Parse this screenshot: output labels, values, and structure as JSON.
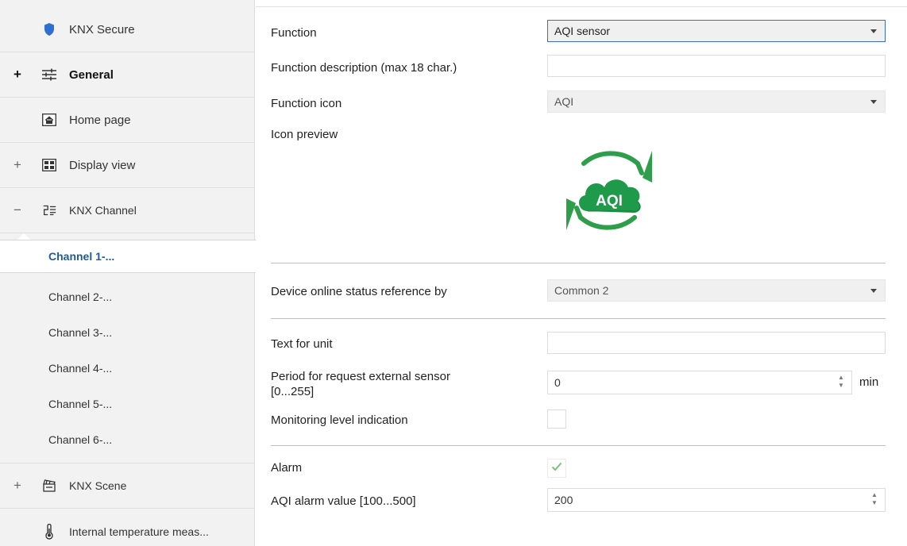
{
  "sidebar": {
    "items": [
      {
        "label": "KNX Secure",
        "expander": "",
        "icon": "shield-icon"
      },
      {
        "label": "General",
        "expander": "+",
        "icon": "sliders-icon"
      },
      {
        "label": "Home page",
        "expander": "",
        "icon": "home-icon"
      },
      {
        "label": "Display view",
        "expander": "+",
        "icon": "display-view-icon"
      },
      {
        "label": "KNX Channel",
        "expander": "−",
        "icon": "knx-channel-icon"
      },
      {
        "label": "KNX Scene",
        "expander": "+",
        "icon": "scene-icon"
      },
      {
        "label": "Internal temperature meas...",
        "expander": "",
        "icon": "thermometer-icon"
      }
    ],
    "channels": [
      "Channel 1-...",
      "Channel 2-...",
      "Channel 3-...",
      "Channel 4-...",
      "Channel 5-...",
      "Channel 6-..."
    ]
  },
  "main": {
    "function": {
      "label": "Function",
      "value": "AQI sensor"
    },
    "function_description": {
      "label": "Function description (max 18 char.)",
      "value": ""
    },
    "function_icon": {
      "label": "Function icon",
      "value": "AQI"
    },
    "icon_preview": {
      "label": "Icon preview",
      "icon_text": "AQI",
      "icon": "aqi-cloud-icon"
    },
    "device_online": {
      "label": "Device online status reference by",
      "value": "Common 2"
    },
    "text_for_unit": {
      "label": "Text for unit",
      "value": ""
    },
    "period": {
      "label_line1": "Period for request external sensor",
      "label_line2": "[0...255]",
      "value": "0",
      "unit": "min"
    },
    "monitoring": {
      "label": "Monitoring level indication",
      "checked": false
    },
    "alarm": {
      "label": "Alarm",
      "checked": true
    },
    "aqi_alarm": {
      "label": "AQI alarm value [100...500]",
      "value": "200"
    }
  },
  "colors": {
    "accent_blue": "#1f5b96",
    "icon_green": "#2e9e4a",
    "check_green": "#7cbf7c",
    "shield_blue": "#2f6fd1"
  }
}
